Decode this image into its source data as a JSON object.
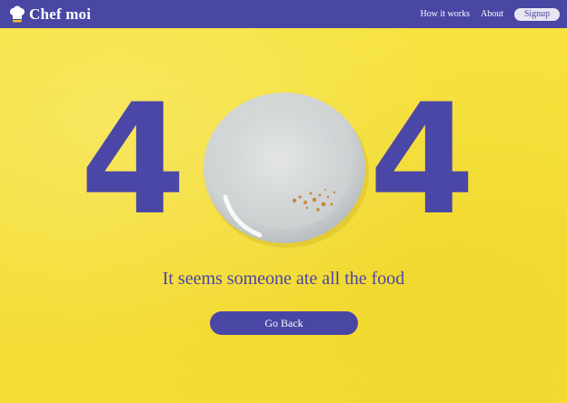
{
  "header": {
    "brand": "Chef moi",
    "links": [
      "How it works",
      "About"
    ],
    "signup_label": "Signup"
  },
  "error": {
    "digit_left": "4",
    "digit_right": "4",
    "message": "It seems someone ate all the food",
    "go_back_label": "Go Back"
  },
  "icons": {
    "logo": "chef-hat-icon",
    "plate": "empty-plate-image"
  },
  "colors": {
    "background": "#f6e03a",
    "accent": "#4a46a4"
  }
}
